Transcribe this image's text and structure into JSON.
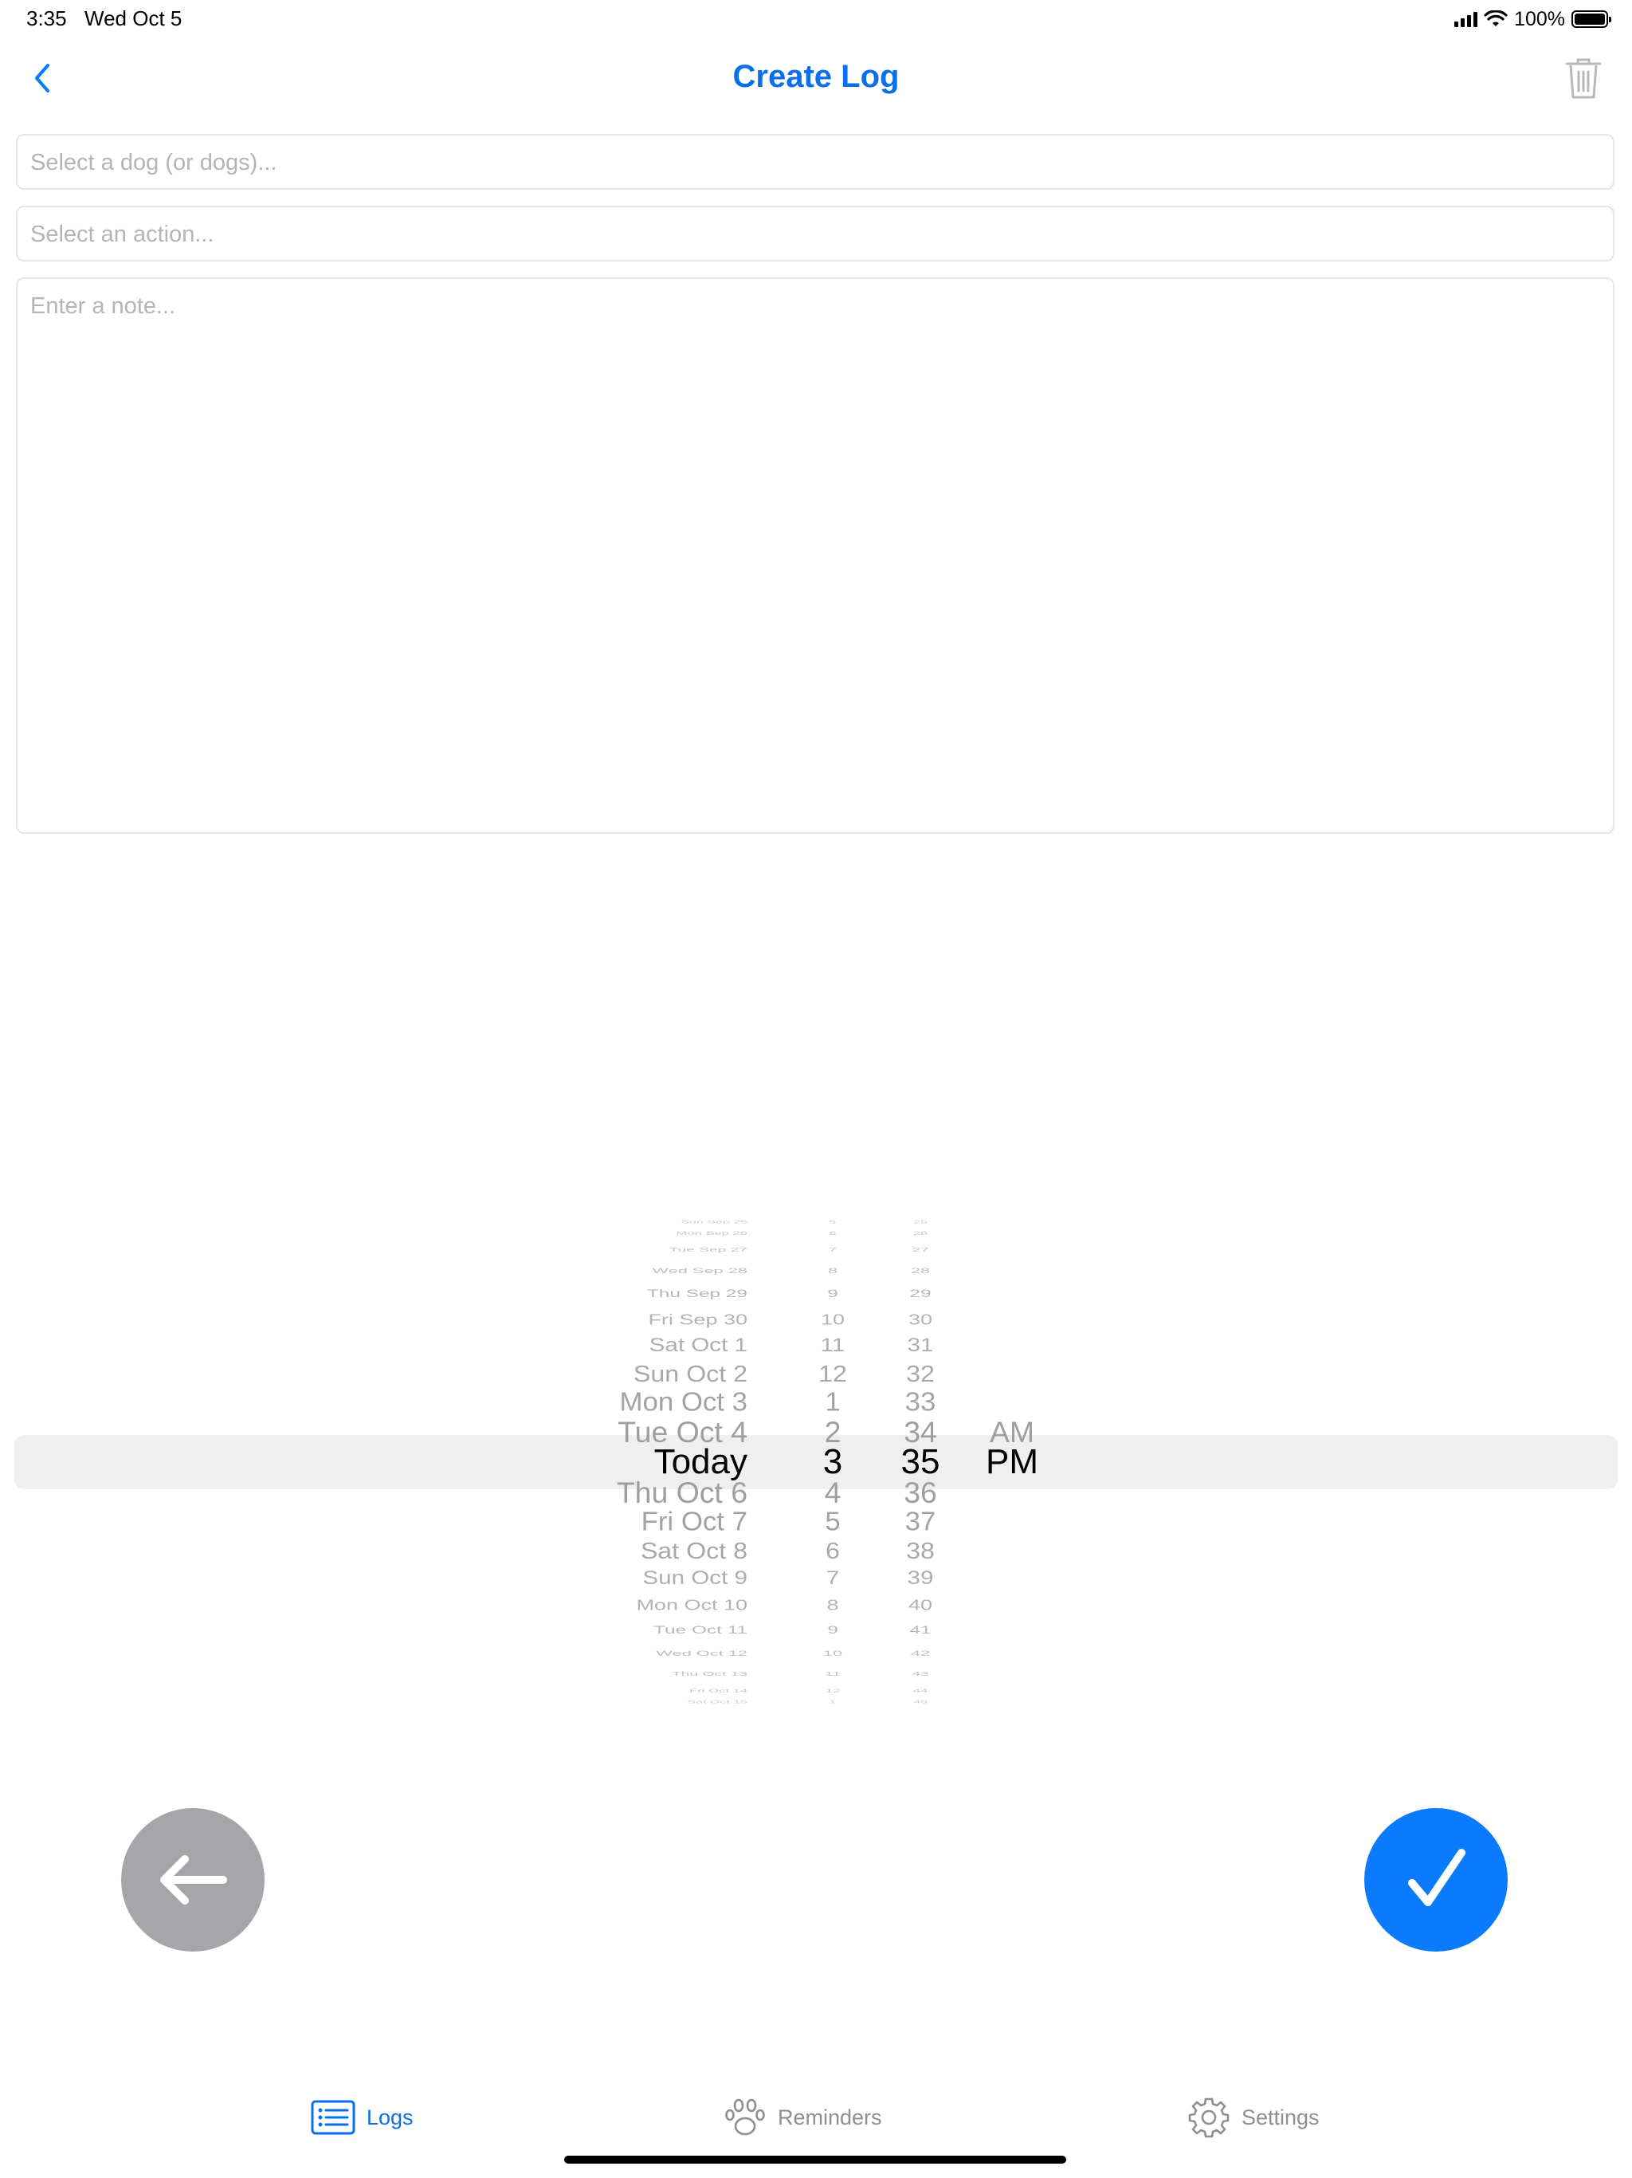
{
  "status_bar": {
    "time": "3:35",
    "date": "Wed Oct 5",
    "battery": "100%"
  },
  "nav": {
    "title": "Create Log"
  },
  "form": {
    "dog_placeholder": "Select a dog (or dogs)...",
    "action_placeholder": "Select an action...",
    "note_placeholder": "Enter a note..."
  },
  "picker": {
    "rows": [
      {
        "date": "Sun Sep 25",
        "hour": "5",
        "minute": "25",
        "ampm": ""
      },
      {
        "date": "Mon Sep 26",
        "hour": "6",
        "minute": "26",
        "ampm": ""
      },
      {
        "date": "Tue Sep 27",
        "hour": "7",
        "minute": "27",
        "ampm": ""
      },
      {
        "date": "Wed Sep 28",
        "hour": "8",
        "minute": "28",
        "ampm": ""
      },
      {
        "date": "Thu Sep 29",
        "hour": "9",
        "minute": "29",
        "ampm": ""
      },
      {
        "date": "Fri Sep 30",
        "hour": "10",
        "minute": "30",
        "ampm": ""
      },
      {
        "date": "Sat Oct 1",
        "hour": "11",
        "minute": "31",
        "ampm": ""
      },
      {
        "date": "Sun Oct 2",
        "hour": "12",
        "minute": "32",
        "ampm": ""
      },
      {
        "date": "Mon Oct 3",
        "hour": "1",
        "minute": "33",
        "ampm": ""
      },
      {
        "date": "Tue Oct 4",
        "hour": "2",
        "minute": "34",
        "ampm": "AM"
      },
      {
        "date": "Today",
        "hour": "3",
        "minute": "35",
        "ampm": "PM"
      },
      {
        "date": "Thu Oct 6",
        "hour": "4",
        "minute": "36",
        "ampm": ""
      },
      {
        "date": "Fri Oct 7",
        "hour": "5",
        "minute": "37",
        "ampm": ""
      },
      {
        "date": "Sat Oct 8",
        "hour": "6",
        "minute": "38",
        "ampm": ""
      },
      {
        "date": "Sun Oct 9",
        "hour": "7",
        "minute": "39",
        "ampm": ""
      },
      {
        "date": "Mon Oct 10",
        "hour": "8",
        "minute": "40",
        "ampm": ""
      },
      {
        "date": "Tue Oct 11",
        "hour": "9",
        "minute": "41",
        "ampm": ""
      },
      {
        "date": "Wed Oct 12",
        "hour": "10",
        "minute": "42",
        "ampm": ""
      },
      {
        "date": "Thu Oct 13",
        "hour": "11",
        "minute": "43",
        "ampm": ""
      },
      {
        "date": "Fri Oct 14",
        "hour": "12",
        "minute": "44",
        "ampm": ""
      },
      {
        "date": "Sat Oct 15",
        "hour": "1",
        "minute": "45",
        "ampm": ""
      }
    ],
    "selected_index": 10
  },
  "tabs": [
    {
      "label": "Logs",
      "icon": "list-icon",
      "active": true
    },
    {
      "label": "Reminders",
      "icon": "paw-icon",
      "active": false
    },
    {
      "label": "Settings",
      "icon": "gear-icon",
      "active": false
    }
  ],
  "colors": {
    "accent": "#0a7aff",
    "title": "#0a6fe8",
    "secondary_button": "#a6a6aa"
  }
}
